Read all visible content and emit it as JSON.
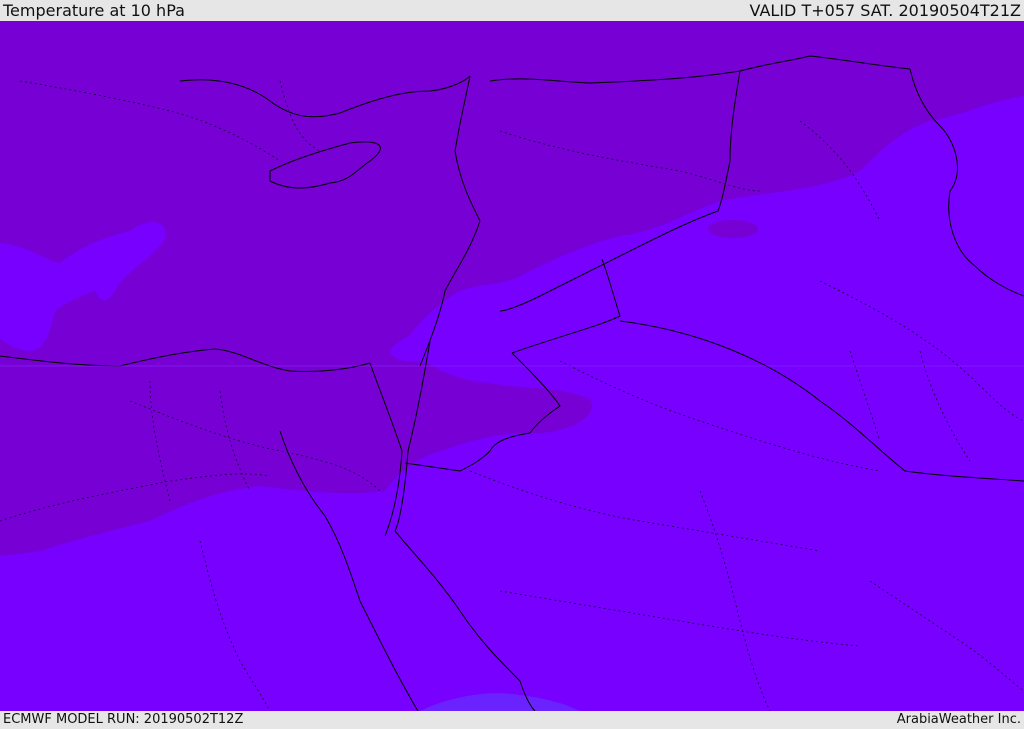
{
  "header": {
    "title": "Temperature at 10 hPa",
    "valid_label": "VALID T+057 SAT. 20190504T21Z"
  },
  "footer": {
    "model_run": "ECMWF MODEL RUN: 20190502T12Z",
    "credit": "ArabiaWeather Inc."
  },
  "colors": {
    "warm_band": "#7700d5",
    "cool_band": "#7700ff",
    "cold_patch": "#6a22ff",
    "bar_bg": "#e6e6e6",
    "coastline": "#000000"
  }
}
